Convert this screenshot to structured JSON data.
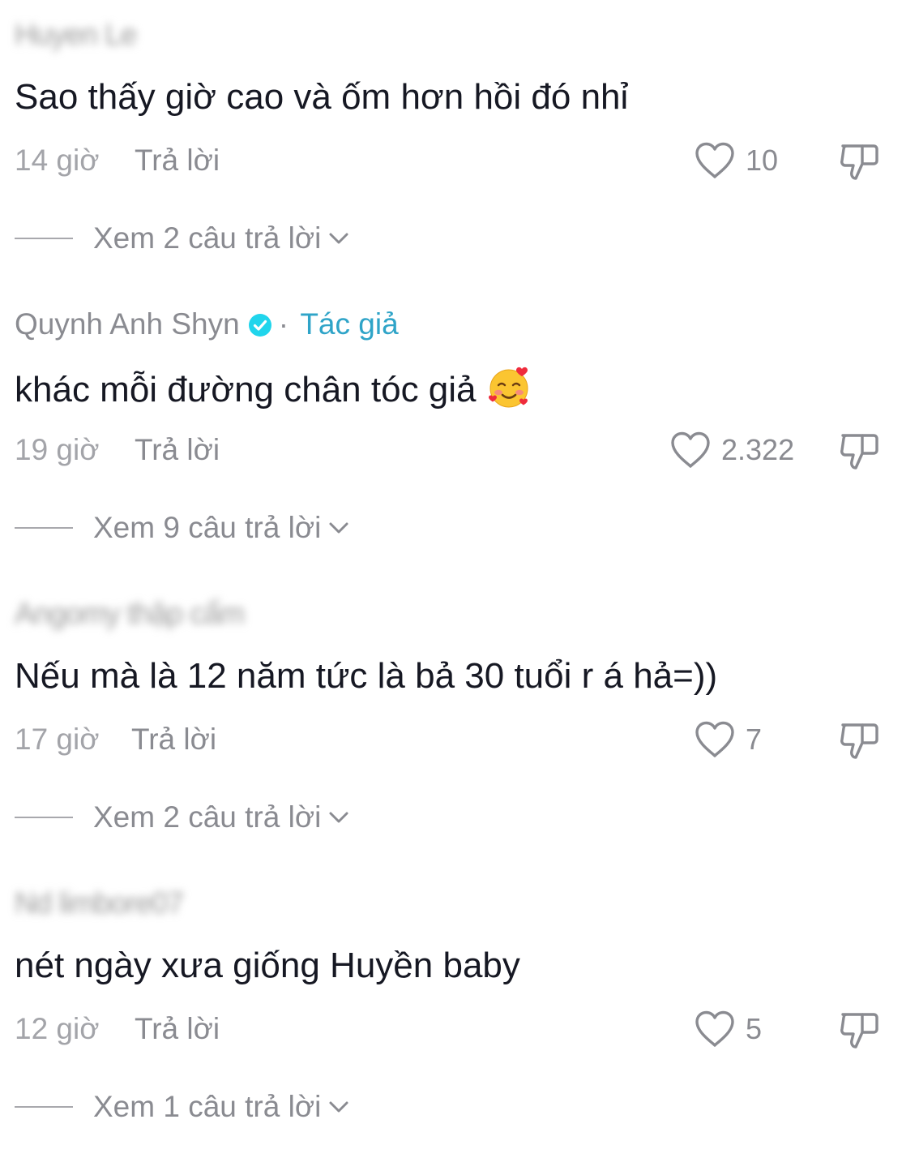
{
  "comments": [
    {
      "username": "Huyen Le",
      "text": "Sao thấy giờ cao và ốm hơn hồi đó nhỉ",
      "time": "14 giờ",
      "reply_label": "Trả lời",
      "likes": "10",
      "view_replies": "Xem 2 câu trả lời"
    },
    {
      "username": "Quynh Anh Shyn",
      "separator": "·",
      "author_tag": "Tác giả",
      "text": "khác mỗi đường chân tóc giả",
      "emoji": "smiling-face-with-hearts",
      "time": "19 giờ",
      "reply_label": "Trả lời",
      "likes": "2.322",
      "view_replies": "Xem 9 câu trả lời"
    },
    {
      "username": "Angomy thập cẩm",
      "text": "Nếu mà là 12 năm tức là bả 30 tuổi r á hả=))",
      "time": "17 giờ",
      "reply_label": "Trả lời",
      "likes": "7",
      "view_replies": "Xem 2 câu trả lời"
    },
    {
      "username": "Nd limbore07",
      "text": "nét ngày xưa giống Huyền baby",
      "time": "12 giờ",
      "reply_label": "Trả lời",
      "likes": "5",
      "view_replies": "Xem 1 câu trả lời"
    }
  ],
  "colors": {
    "text_primary": "#161823",
    "text_secondary": "#8a8b91",
    "author_tag": "#2fa4c8",
    "verified_badge": "#20d5ec"
  }
}
